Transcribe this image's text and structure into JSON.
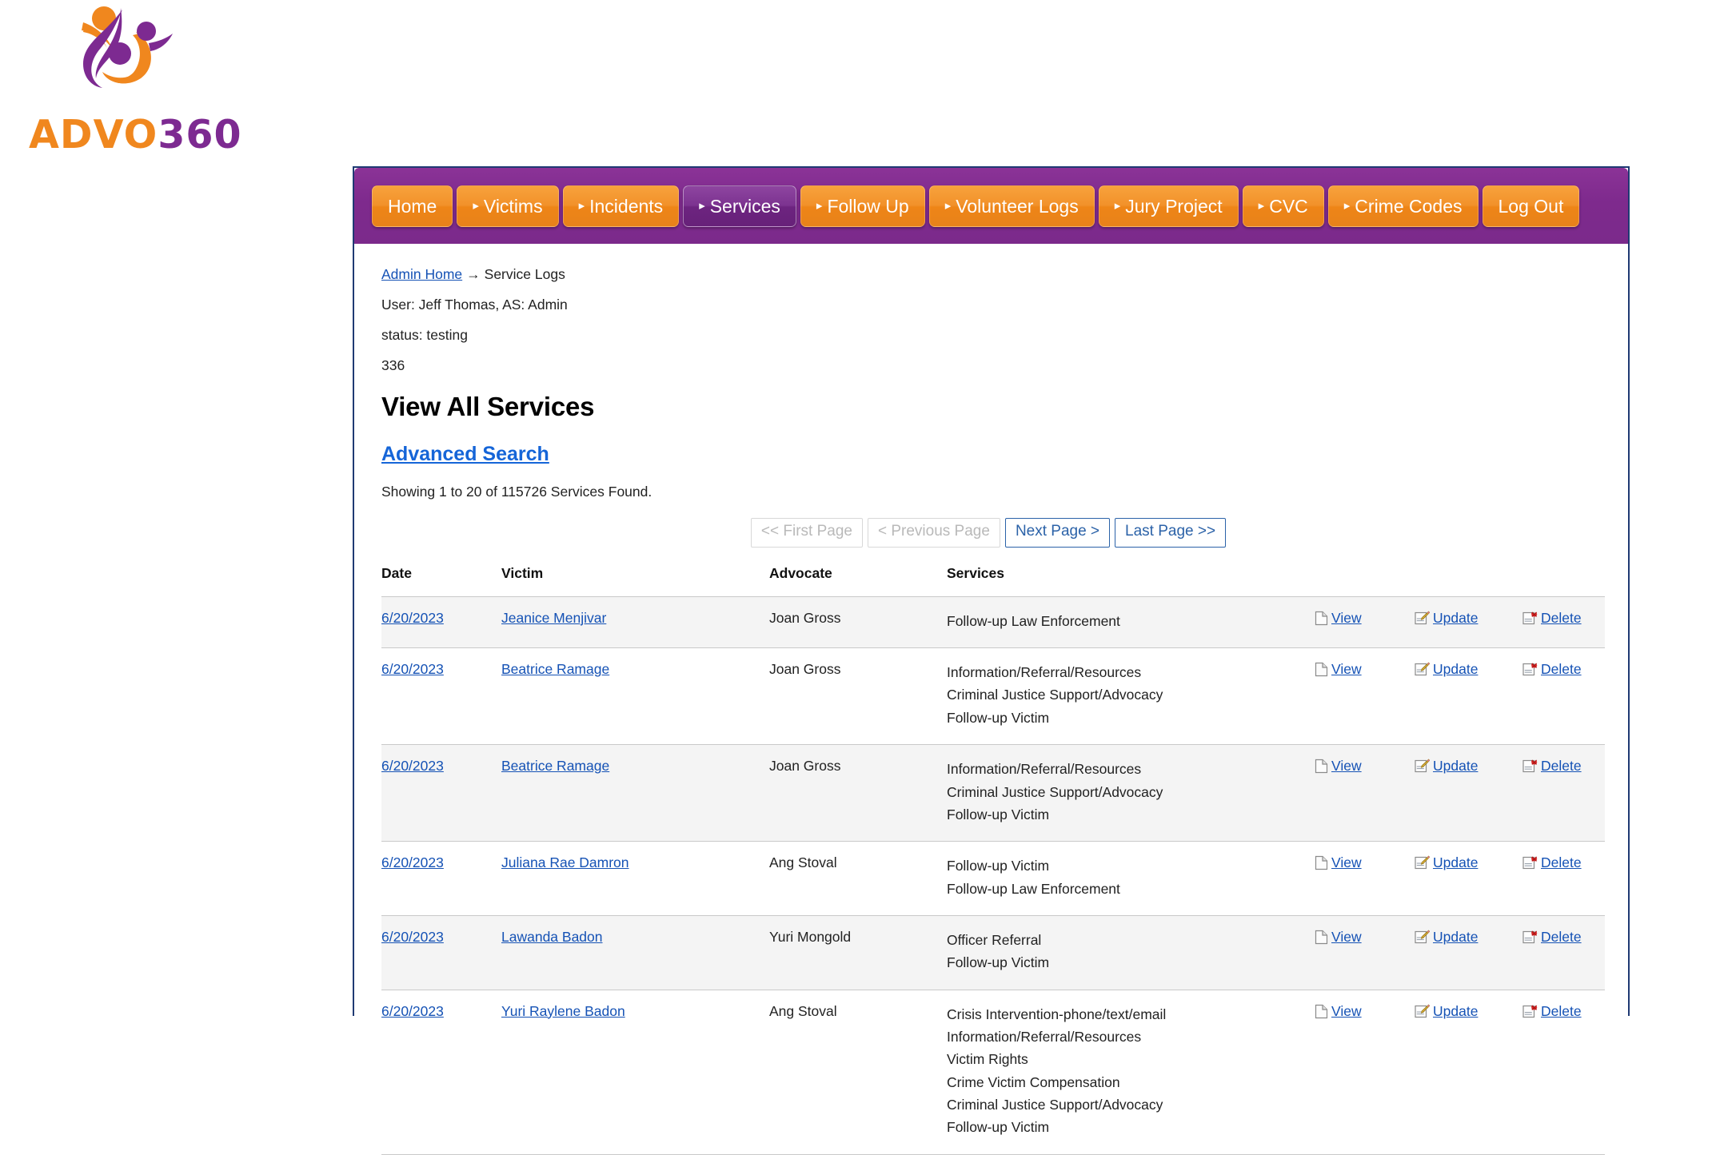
{
  "brand": {
    "wordmark_part1": "ADVO",
    "wordmark_part2": "360",
    "logo_icon": "advo360-people-logo"
  },
  "nav": {
    "items": [
      {
        "label": "Home",
        "caret": false,
        "active": false
      },
      {
        "label": "Victims",
        "caret": true,
        "active": false
      },
      {
        "label": "Incidents",
        "caret": true,
        "active": false
      },
      {
        "label": "Services",
        "caret": true,
        "active": true
      },
      {
        "label": "Follow Up",
        "caret": true,
        "active": false
      },
      {
        "label": "Volunteer Logs",
        "caret": true,
        "active": false
      },
      {
        "label": "Jury Project",
        "caret": true,
        "active": false
      },
      {
        "label": "CVC",
        "caret": true,
        "active": false
      },
      {
        "label": "Crime Codes",
        "caret": true,
        "active": false
      },
      {
        "label": "Log Out",
        "caret": false,
        "active": false
      }
    ],
    "caret_glyph": "▸"
  },
  "breadcrumb": {
    "home_label": "Admin Home",
    "arrow": "→",
    "current": "Service Logs"
  },
  "meta": {
    "user_line": "User: Jeff Thomas, AS: Admin",
    "status_line": "status: testing",
    "count_line": "336"
  },
  "page": {
    "title": "View All Services",
    "advanced_search": "Advanced Search",
    "showing": "Showing 1 to 20 of 115726 Services Found."
  },
  "pagination": {
    "first": "<< First Page",
    "previous": "< Previous Page",
    "next": "Next Page >",
    "last": "Last Page >>"
  },
  "table": {
    "headers": {
      "date": "Date",
      "victim": "Victim",
      "advocate": "Advocate",
      "services": "Services",
      "view": "",
      "update": "",
      "delete": ""
    },
    "actions": {
      "view": "View",
      "update": "Update",
      "delete": "Delete",
      "view_icon": "document-icon",
      "update_icon": "pencil-edit-icon",
      "delete_icon": "delete-x-icon"
    },
    "rows": [
      {
        "date": "6/20/2023",
        "victim": "Jeanice Menjivar",
        "advocate": "Joan Gross",
        "services": [
          "Follow-up Law Enforcement"
        ]
      },
      {
        "date": "6/20/2023",
        "victim": "Beatrice Ramage",
        "advocate": "Joan Gross",
        "services": [
          "Information/Referral/Resources",
          "Criminal Justice Support/Advocacy",
          "Follow-up Victim"
        ]
      },
      {
        "date": "6/20/2023",
        "victim": "Beatrice Ramage",
        "advocate": "Joan Gross",
        "services": [
          "Information/Referral/Resources",
          "Criminal Justice Support/Advocacy",
          "Follow-up Victim"
        ]
      },
      {
        "date": "6/20/2023",
        "victim": "Juliana Rae Damron",
        "advocate": "Ang Stoval",
        "services": [
          "Follow-up Victim",
          "Follow-up Law Enforcement"
        ]
      },
      {
        "date": "6/20/2023",
        "victim": "Lawanda Badon",
        "advocate": "Yuri Mongold",
        "services": [
          "Officer Referral",
          "Follow-up Victim"
        ]
      },
      {
        "date": "6/20/2023",
        "victim": "Yuri Raylene Badon",
        "advocate": "Ang Stoval",
        "services": [
          "Crisis Intervention-phone/text/email",
          "Information/Referral/Resources",
          "Victim Rights",
          "Crime Victim Compensation",
          "Criminal Justice Support/Advocacy",
          "Follow-up Victim"
        ]
      }
    ]
  },
  "colors": {
    "brand_orange": "#F0871E",
    "brand_purple": "#7D2A91",
    "nav_bar_purple": "#7E2A8D",
    "link_blue": "#1552B5",
    "frame_border": "#1F3A73",
    "row_alt": "#F4F4F4"
  }
}
